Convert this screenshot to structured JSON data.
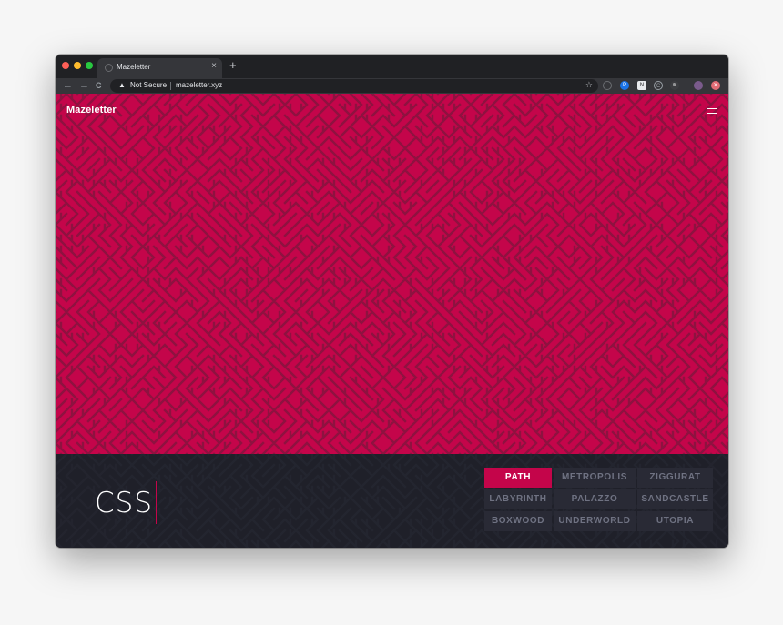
{
  "browser": {
    "tab_title": "Mazeletter",
    "tab_close": "×",
    "new_tab": "+",
    "nav_back": "←",
    "nav_forward": "→",
    "nav_reload": "C",
    "security_label": "Not Secure",
    "url": "mazeletter.xyz",
    "star": "☆"
  },
  "page": {
    "logo": "Mazeletter",
    "preview_text": "CSS",
    "accent_color": "#c4054a",
    "fonts": [
      {
        "label": "PATH",
        "active": true
      },
      {
        "label": "METROPOLIS",
        "active": false
      },
      {
        "label": "ZIGGURAT",
        "active": false
      },
      {
        "label": "LABYRINTH",
        "active": false
      },
      {
        "label": "PALAZZO",
        "active": false
      },
      {
        "label": "SANDCASTLE",
        "active": false
      },
      {
        "label": "BOXWOOD",
        "active": false
      },
      {
        "label": "UNDERWORLD",
        "active": false
      },
      {
        "label": "UTOPIA",
        "active": false
      }
    ]
  }
}
